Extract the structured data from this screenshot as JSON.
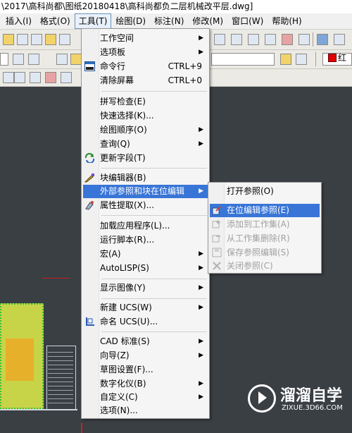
{
  "window": {
    "title": "\\2017\\高科尚都\\图纸20180418\\高科尚都负二层机械改平层.dwg]"
  },
  "menubar": {
    "items": [
      "插入(I)",
      "格式(O)",
      "工具(T)",
      "绘图(D)",
      "标注(N)",
      "修改(M)",
      "窗口(W)",
      "帮助(H)"
    ],
    "active": "工具(T)"
  },
  "toolbar": {
    "color_label": "红",
    "color_value": "#e00000"
  },
  "tools_menu": {
    "items": [
      {
        "label": "工作空间",
        "shortcut": "",
        "submenu": true
      },
      {
        "label": "选项板",
        "shortcut": "",
        "submenu": true
      },
      {
        "label": "命令行",
        "shortcut": "CTRL+9",
        "submenu": false,
        "icon": "command-line-icon"
      },
      {
        "label": "清除屏幕",
        "shortcut": "CTRL+0",
        "submenu": false
      },
      {
        "label": "拼写检查(E)",
        "shortcut": "",
        "submenu": false
      },
      {
        "label": "快速选择(K)...",
        "shortcut": "",
        "submenu": false
      },
      {
        "label": "绘图顺序(O)",
        "shortcut": "",
        "submenu": true
      },
      {
        "label": "查询(Q)",
        "shortcut": "",
        "submenu": true
      },
      {
        "label": "更新字段(T)",
        "shortcut": "",
        "submenu": false,
        "icon": "update-fields-icon"
      },
      {
        "label": "块编辑器(B)",
        "shortcut": "",
        "submenu": false,
        "icon": "block-editor-icon"
      },
      {
        "label": "外部参照和块在位编辑",
        "shortcut": "",
        "submenu": true,
        "highlighted": true
      },
      {
        "label": "属性提取(X)...",
        "shortcut": "",
        "submenu": false,
        "icon": "attribute-extract-icon"
      },
      {
        "label": "加载应用程序(L)...",
        "shortcut": "",
        "submenu": false
      },
      {
        "label": "运行脚本(R)...",
        "shortcut": "",
        "submenu": false
      },
      {
        "label": "宏(A)",
        "shortcut": "",
        "submenu": true
      },
      {
        "label": "AutoLISP(S)",
        "shortcut": "",
        "submenu": true
      },
      {
        "label": "显示图像(Y)",
        "shortcut": "",
        "submenu": true
      },
      {
        "label": "新建 UCS(W)",
        "shortcut": "",
        "submenu": true
      },
      {
        "label": "命名 UCS(U)...",
        "shortcut": "",
        "submenu": false,
        "icon": "named-ucs-icon"
      },
      {
        "label": "CAD 标准(S)",
        "shortcut": "",
        "submenu": true
      },
      {
        "label": "向导(Z)",
        "shortcut": "",
        "submenu": true
      },
      {
        "label": "草图设置(F)...",
        "shortcut": "",
        "submenu": false
      },
      {
        "label": "数字化仪(B)",
        "shortcut": "",
        "submenu": true
      },
      {
        "label": "自定义(C)",
        "shortcut": "",
        "submenu": true
      },
      {
        "label": "选项(N)...",
        "shortcut": "",
        "submenu": false
      }
    ]
  },
  "xref_submenu": {
    "items": [
      {
        "label": "打开参照(O)",
        "disabled": false,
        "highlighted": false
      },
      {
        "label": "在位编辑参照(E)",
        "disabled": false,
        "highlighted": true,
        "icon": "edit-reference-icon"
      },
      {
        "label": "添加到工作集(A)",
        "disabled": true,
        "highlighted": false,
        "icon": "add-workset-icon"
      },
      {
        "label": "从工作集删除(R)",
        "disabled": true,
        "highlighted": false,
        "icon": "remove-workset-icon"
      },
      {
        "label": "保存参照编辑(S)",
        "disabled": true,
        "highlighted": false,
        "icon": "save-reference-icon"
      },
      {
        "label": "关闭参照(C)",
        "disabled": true,
        "highlighted": false,
        "icon": "close-reference-icon"
      }
    ]
  },
  "watermark": {
    "brand": "溜溜自学",
    "url": "ZIXUE.3D66.COM"
  }
}
